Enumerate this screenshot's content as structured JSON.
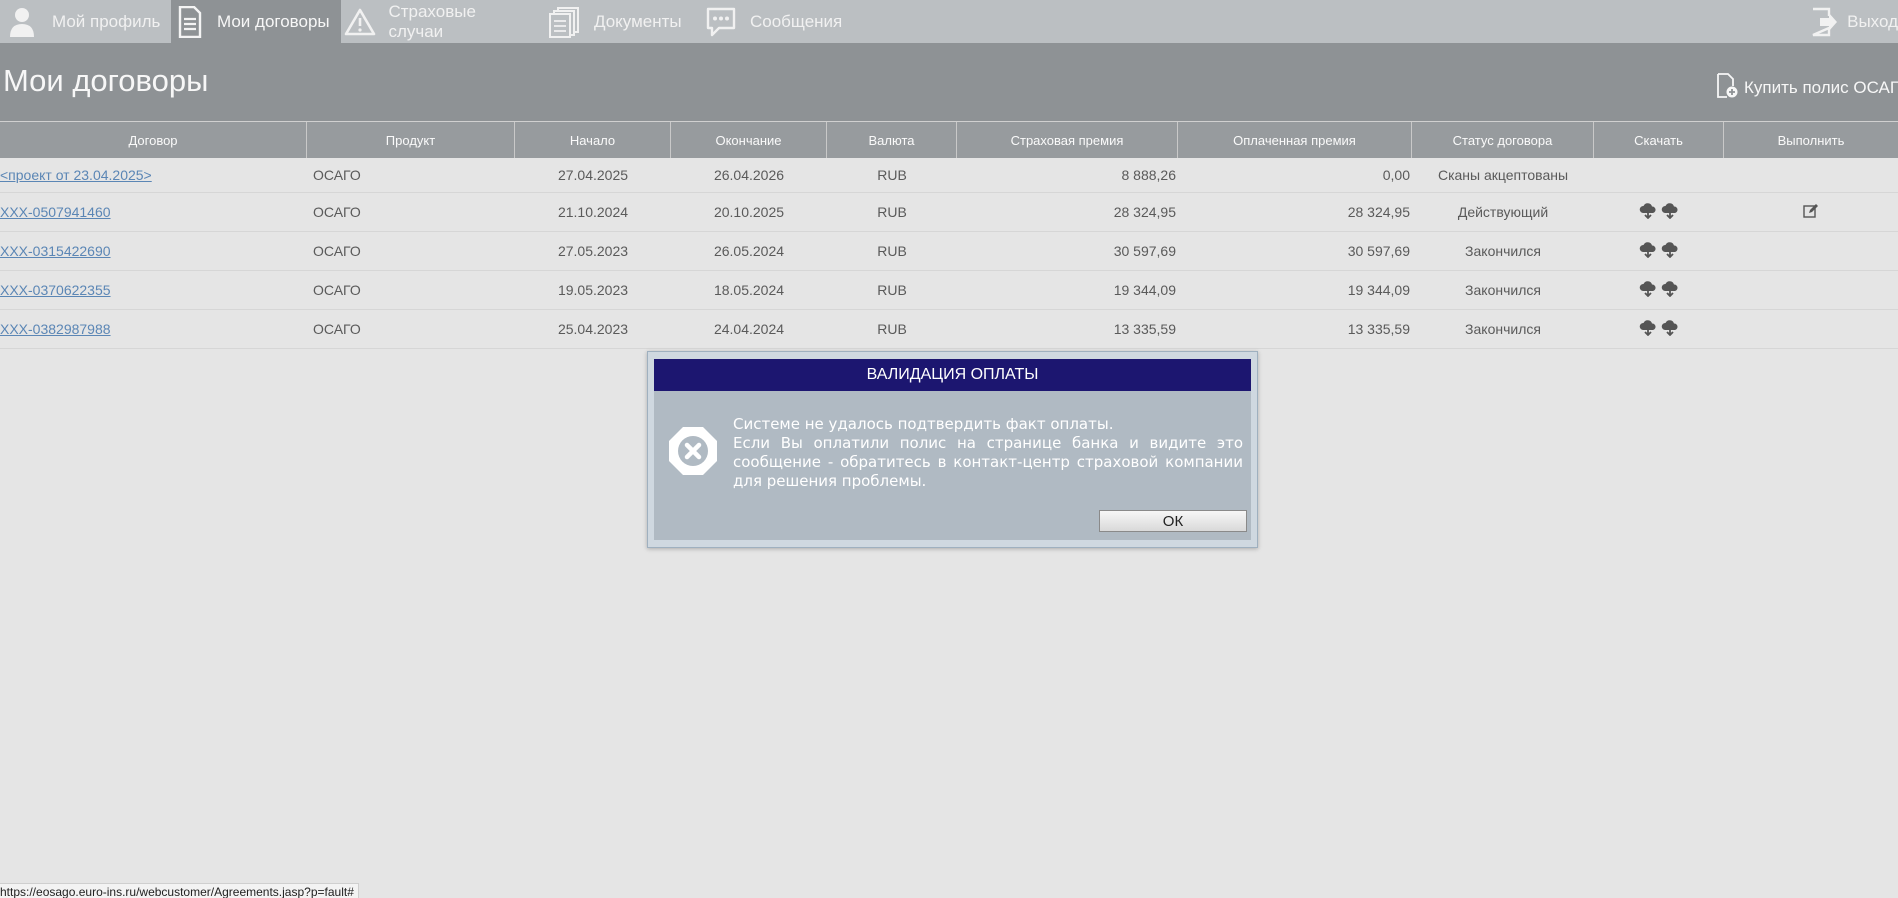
{
  "nav": {
    "items": [
      {
        "label": "Мой профиль",
        "icon": "user-icon"
      },
      {
        "label": "Мои договоры",
        "icon": "document-icon"
      },
      {
        "label": "Страховые случаи",
        "icon": "warning-icon"
      },
      {
        "label": "Документы",
        "icon": "documents-icon"
      },
      {
        "label": "Сообщения",
        "icon": "message-icon"
      }
    ],
    "active": "Мои договоры",
    "logout_label": "Выход"
  },
  "page": {
    "title": "Мои договоры",
    "buy_label": "Купить полис ОСАГО"
  },
  "table": {
    "headers": {
      "contract": "Договор",
      "product": "Продукт",
      "start": "Начало",
      "end": "Окончание",
      "currency": "Валюта",
      "premium": "Страховая премия",
      "paid": "Оплаченная премия",
      "status": "Статус договора",
      "download": "Скачать",
      "execute": "Выполнить"
    },
    "rows": [
      {
        "contract": "<проект от 23.04.2025>",
        "product": "ОСАГО",
        "start": "27.04.2025",
        "end": "26.04.2026",
        "currency": "RUB",
        "premium": "8 888,26",
        "paid": "0,00",
        "status": "Сканы акцептованы",
        "download": false,
        "execute": false
      },
      {
        "contract": "XXX-0507941460",
        "product": "ОСАГО",
        "start": "21.10.2024",
        "end": "20.10.2025",
        "currency": "RUB",
        "premium": "28 324,95",
        "paid": "28 324,95",
        "status": "Действующий",
        "download": true,
        "execute": true
      },
      {
        "contract": "XXX-0315422690",
        "product": "ОСАГО",
        "start": "27.05.2023",
        "end": "26.05.2024",
        "currency": "RUB",
        "premium": "30 597,69",
        "paid": "30 597,69",
        "status": "Закончился",
        "download": true,
        "execute": false
      },
      {
        "contract": "XXX-0370622355",
        "product": "ОСАГО",
        "start": "19.05.2023",
        "end": "18.05.2024",
        "currency": "RUB",
        "premium": "19 344,09",
        "paid": "19 344,09",
        "status": "Закончился",
        "download": true,
        "execute": false
      },
      {
        "contract": "XXX-0382987988",
        "product": "ОСАГО",
        "start": "25.04.2023",
        "end": "24.04.2024",
        "currency": "RUB",
        "premium": "13 335,59",
        "paid": "13 335,59",
        "status": "Закончился",
        "download": true,
        "execute": false
      }
    ]
  },
  "dialog": {
    "title": "ВАЛИДАЦИЯ ОПЛАТЫ",
    "line1": "Системе не удалось подтвердить факт оплаты.",
    "line2": "Если Вы оплатили полис на странице банка и видите это сообщение - обратитесь в контакт-центр страховой компании для решения проблемы.",
    "ok_label": "ОК",
    "icon": "error-icon"
  },
  "statusbar": {
    "url": "https://eosago.euro-ins.ru/webcustomer/Agreements.jasp?p=fault#"
  },
  "colors": {
    "nav_bg": "#bbbfc2",
    "header_bg": "#8e9295",
    "dialog_header": "#1c1670",
    "link": "#5b86b5"
  }
}
